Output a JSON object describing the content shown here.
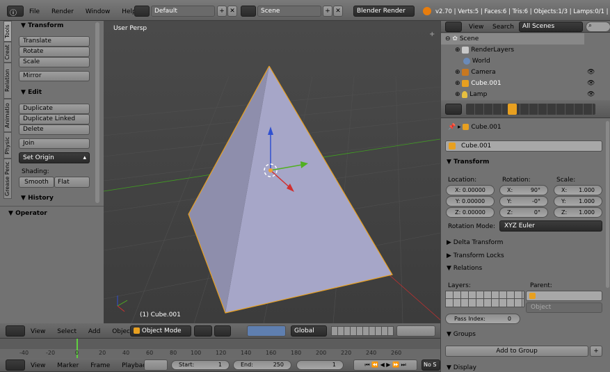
{
  "topbar": {
    "menus": [
      "File",
      "Render",
      "Window",
      "Help"
    ],
    "layout": "Default",
    "scene": "Scene",
    "engine": "Blender Render",
    "stats": "v2.70 | Verts:5 | Faces:6 | Tris:6 | Objects:1/3 | Lamps:0/1 | Mem"
  },
  "toolshelf": {
    "tabs": [
      "Tools",
      "Creat",
      "Relation",
      "Animatio",
      "Physic",
      "Grease Penc"
    ],
    "transform_header": "Transform",
    "translate": "Translate",
    "rotate": "Rotate",
    "scale": "Scale",
    "mirror": "Mirror",
    "edit_header": "Edit",
    "duplicate": "Duplicate",
    "duplicate_linked": "Duplicate Linked",
    "delete": "Delete",
    "join": "Join",
    "set_origin": "Set Origin",
    "shading_label": "Shading:",
    "smooth": "Smooth",
    "flat": "Flat",
    "history_header": "History",
    "operator_header": "Operator"
  },
  "viewport": {
    "view_label": "User Persp",
    "object_label": "(1) Cube.001",
    "header_menus": [
      "View",
      "Select",
      "Add",
      "Object"
    ],
    "mode": "Object Mode",
    "orientation": "Global"
  },
  "timeline": {
    "ticks": [
      "-40",
      "-20",
      "0",
      "20",
      "40",
      "60",
      "80",
      "100",
      "120",
      "140",
      "160",
      "180",
      "200",
      "220",
      "240",
      "260"
    ],
    "menus": [
      "View",
      "Marker",
      "Frame",
      "Playback"
    ],
    "start_label": "Start:",
    "start_value": "1",
    "end_label": "End:",
    "end_value": "250",
    "current": "1",
    "nosync": "No S"
  },
  "outliner": {
    "view": "View",
    "search": "Search",
    "filter": "All Scenes",
    "items": [
      "Scene",
      "RenderLayers",
      "World",
      "Camera",
      "Cube.001",
      "Lamp"
    ]
  },
  "properties": {
    "breadcrumb": "Cube.001",
    "name_field": "Cube.001",
    "transform_header": "Transform",
    "location_label": "Location:",
    "rotation_label": "Rotation:",
    "scale_label": "Scale:",
    "loc": [
      "X: 0.00000",
      "Y: 0.00000",
      "Z: 0.00000"
    ],
    "rot_axes": [
      "X:",
      "Y:",
      "Z:"
    ],
    "rot_vals": [
      "90°",
      "-0°",
      "0°"
    ],
    "scl_axes": [
      "X:",
      "Y:",
      "Z:"
    ],
    "scl_vals": [
      "1.000",
      "1.000",
      "1.000"
    ],
    "rotation_mode_label": "Rotation Mode:",
    "rotation_mode": "XYZ Euler",
    "delta_header": "Delta Transform",
    "locks_header": "Transform Locks",
    "relations_header": "Relations",
    "layers_label": "Layers:",
    "parent_label": "Parent:",
    "parent_type": "Object",
    "pass_index_label": "Pass Index:",
    "pass_index_value": "0",
    "groups_header": "Groups",
    "add_to_group": "Add to Group",
    "display_header": "Display"
  },
  "colors": {
    "selected_outline": "#e8a020",
    "x_axis": "#d03030",
    "y_axis": "#50b020",
    "z_axis": "#3050d0",
    "selected_text": "#ffaa40"
  }
}
